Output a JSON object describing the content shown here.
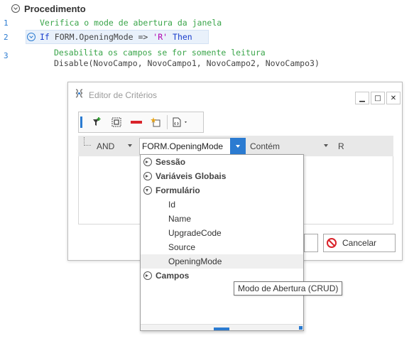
{
  "procedure": {
    "title": "Procedimento"
  },
  "code_lines": [
    {
      "number": "1",
      "text": "Verifica o mode de abertura da janela"
    },
    {
      "number": "2",
      "kw_if": "If",
      "expr": "FORM.OpeningMode =>",
      "str": "'R'",
      "kw_then": "Then"
    },
    {
      "number": "3",
      "comment": "Desabilita os campos se for somente leitura",
      "call": "Disable(NovoCampo, NovoCampo1, NovoCampo2, NovoCampo3)"
    }
  ],
  "dialog": {
    "title": "Editor de Critérios",
    "window_controls": {
      "minimize": "▁",
      "maximize": "□",
      "close": "✕"
    },
    "criteria_row": {
      "logic": "AND",
      "field": "FORM.OpeningMode",
      "operator": "Contém",
      "value": "R"
    },
    "cancel_label": "Cancelar"
  },
  "field_tree": {
    "groups": [
      {
        "label": "Sessão",
        "expanded": false
      },
      {
        "label": "Variáveis Globais",
        "expanded": false
      },
      {
        "label": "Formulário",
        "expanded": true,
        "items": [
          "Id",
          "Name",
          "UpgradeCode",
          "Source",
          "OpeningMode"
        ]
      },
      {
        "label": "Campos",
        "expanded": false
      }
    ],
    "hovered_item": "OpeningMode"
  },
  "tooltip": "Modo de Abertura (CRUD)",
  "icons": [
    "collapse-icon",
    "step-icon",
    "editor-icon",
    "add-filter-icon",
    "group-icon",
    "remove-icon",
    "new-item-icon",
    "script-icon",
    "cancel-icon"
  ],
  "colors": {
    "accent": "#2b7bd1",
    "comment": "#3aa54a",
    "keyword": "#1a3ecc",
    "string": "#b000b0",
    "remove": "#d9232a"
  }
}
